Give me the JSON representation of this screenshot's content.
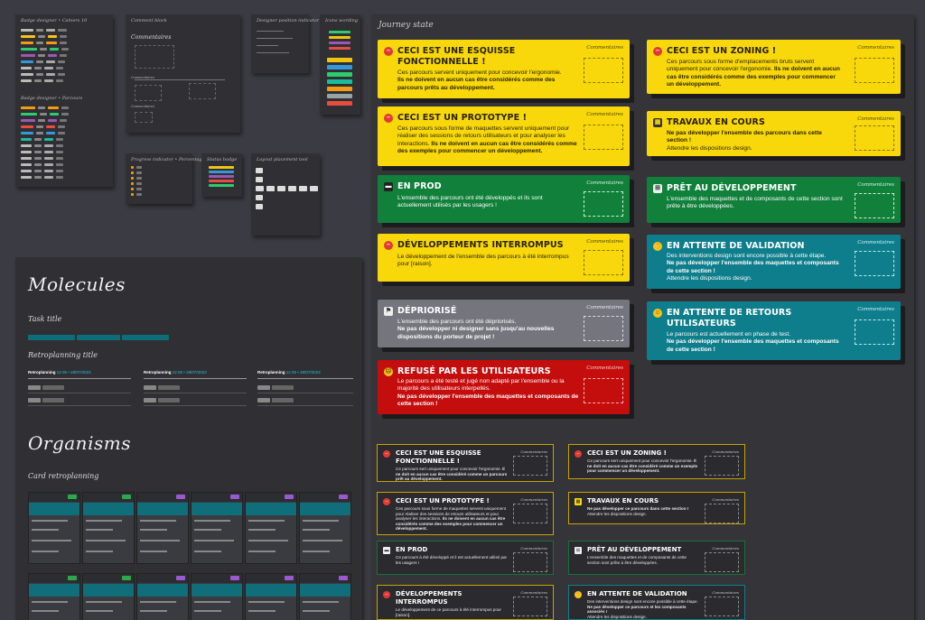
{
  "top_frames": {
    "badge_frame_title_1": "Badge designer • Cahiers 10",
    "badge_frame_title_2": "Badge designer • Parcours",
    "comment_frame_title": "Comment block",
    "comment_label": "Commentaires",
    "designer_frame_title": "Designer position indicator",
    "tools_frame_title": "Icons wording",
    "progress_frame_title": "Progress indicator • Percentage",
    "status_frame_title": "Status badge",
    "content_frame_title": "Layout placement tool"
  },
  "journey": {
    "title": "Journey state",
    "comment_label": "Commentaires",
    "cards": [
      {
        "id": "esquisse",
        "title": "CECI EST UNE ESQUISSE FONCTIONNELLE !",
        "text": "Ces parcours servent uniquement pour concevoir l'ergonomie.",
        "bold": "Ils ne doivent en aucun cas être considérés comme des parcours prêts au développement."
      },
      {
        "id": "zoning",
        "title": "CECI EST UN ZONING !",
        "text": "Ces parcours sous forme d'emplacements bruts servent uniquement pour concevoir l'ergonomie.",
        "bold": "Ils ne doivent en aucun cas être considérés comme des exemples pour commencer un développement."
      },
      {
        "id": "prototype",
        "title": "CECI EST UN PROTOTYPE !",
        "text": "Ces parcours sous forme de maquettes servent uniquement pour réaliser des sessions de retours utilisateurs et pour analyser les interactions.",
        "bold": "Ils ne doivent en aucun cas être considérés comme des exemples pour commencer un développement."
      },
      {
        "id": "travaux",
        "title": "TRAVAUX EN COURS",
        "text": "",
        "bold": "Ne pas développer l'ensemble des parcours dans cette section !",
        "extra": "Attendre les dispositions design."
      },
      {
        "id": "prod",
        "title": "EN PROD",
        "text": "L'ensemble des parcours ont été développés et ils sont actuellement utilisés par les usagers !",
        "bold": ""
      },
      {
        "id": "pret",
        "title": "PRÊT AU DÉVELOPPEMENT",
        "text": "L'ensemble des maquettes et de composants de cette section sont prête à être développées.",
        "bold": ""
      },
      {
        "id": "interrompus",
        "title": "DÉVELOPPEMENTS INTERROMPUS",
        "text": "Le développement de l'ensemble des parcours à été interrompus pour [raison].",
        "bold": ""
      },
      {
        "id": "validation",
        "title": "EN ATTENTE DE VALIDATION",
        "text": "Des interventions design sont encore possible à cette étape.",
        "bold": "Ne pas développer l'ensemble des maquettes et composants de cette section !",
        "extra": "Attendre les dispositions design."
      },
      {
        "id": "deprio",
        "title": "DÉPRIORISÉ",
        "text": "L'ensemble des parcours ont été dépriorisés.",
        "bold": "Ne pas développer ni designer sans jusqu'au nouvelles dispositions du porteur de projet !"
      },
      {
        "id": "retours",
        "title": "EN ATTENTE DE RETOURS UTILISATEURS",
        "text": "Le parcours est actuellement en phase de test.",
        "bold": "Ne pas développer l'ensemble des maquettes et composants de cette section !"
      },
      {
        "id": "refuse",
        "title": "REFUSÉ PAR LES UTILISATEURS",
        "text": "Le parcours a été testé et jugé non adapté par l'ensemble ou la majorité des utilisateurs interpellés.",
        "bold": "Ne pas développer l'ensemble des maquettes et composants de cette section !"
      }
    ],
    "outline_cards": [
      {
        "title": "CECI EST UNE ESQUISSE FONCTIONNELLE !",
        "text": "Ce parcours sert uniquement pour concevoir l'ergonomie.",
        "bold": "Il ne doit en aucun cas être considéré comme un parcours prêt au développement."
      },
      {
        "title": "CECI EST UN ZONING !",
        "text": "Ce parcours sert uniquement pour concevoir l'ergonomie.",
        "bold": "Il ne doit en aucun cas être considéré comme un exemple pour commencer un développement."
      },
      {
        "title": "CECI EST UN PROTOTYPE !",
        "text": "Ces parcours sous forme de maquettes servent uniquement pour réaliser des sessions de retours utilisateurs et pour analyser les interactions.",
        "bold": "Ils ne doivent en aucun cas être considérés comme des exemples pour commencer un développement."
      },
      {
        "title": "TRAVAUX EN COURS",
        "text": "",
        "bold": "Ne pas développer ce parcours dans cette section !",
        "extra": "Attendre les dispositions design."
      },
      {
        "title": "EN PROD",
        "text": "Ce parcours à été développé et il est actuellement utilisé par les usagers !",
        "bold": ""
      },
      {
        "title": "PRÊT AU DÉVELOPPEMENT",
        "text": "L'ensemble des maquettes et de composants de cette section sont prête à être développées.",
        "bold": ""
      },
      {
        "title": "DÉVELOPPEMENTS INTERROMPUS",
        "text": "Le développement de ce parcours à été interrompus pour [raison].",
        "bold": ""
      },
      {
        "title": "EN ATTENTE DE VALIDATION",
        "text": "Des interventions design sont encore possible à cette étape.",
        "bold": "Ne pas développer ce parcours et les composants associés !",
        "extra": "Attendre les dispositions design."
      }
    ]
  },
  "molecules": {
    "title": "Molecules",
    "task_title": "Task title",
    "retro_title": "Retroplanning title",
    "retro_label": "Retroplanning",
    "retro_sub": "12.05 • 28/07/2023"
  },
  "organisms": {
    "title": "Organisms",
    "card_title": "Card retroplanning"
  },
  "colors": {
    "yellow": "#f8d80a",
    "green": "#10803a",
    "teal": "#0f7e8c",
    "grey": "#74757d",
    "red": "#c40d0d"
  }
}
